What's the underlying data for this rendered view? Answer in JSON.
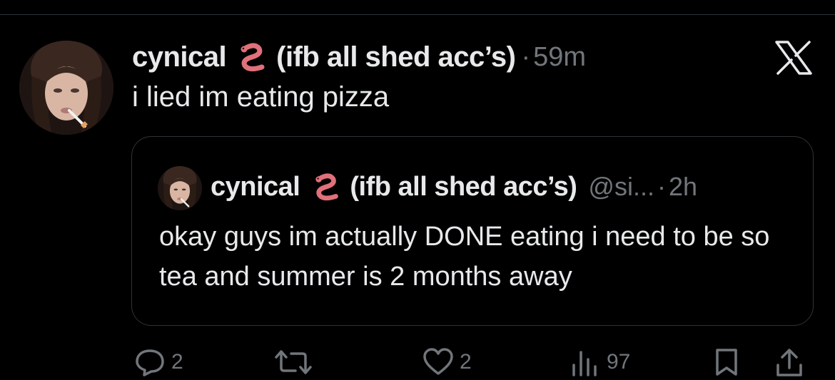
{
  "tweet": {
    "author_name": "cynical",
    "author_suffix": "(ifb all shed acc’s)",
    "name_emoji": "worm-icon",
    "timestamp": "59m",
    "separator": "·",
    "text": "i lied im eating pizza"
  },
  "quoted_tweet": {
    "author_name": "cynical",
    "author_suffix": "(ifb all shed acc’s)",
    "name_emoji": "worm-icon",
    "handle": "@si...",
    "separator": "·",
    "timestamp": "2h",
    "text": "okay guys im actually DONE eating i need to be so tea and summer is 2 months away"
  },
  "actions": {
    "replies": "2",
    "reposts": "",
    "likes": "2",
    "views": "97"
  },
  "colors": {
    "background": "#000000",
    "text_primary": "#e7e9ea",
    "text_secondary": "#71767b",
    "border": "#2f3336",
    "worm": "#e0707a"
  }
}
